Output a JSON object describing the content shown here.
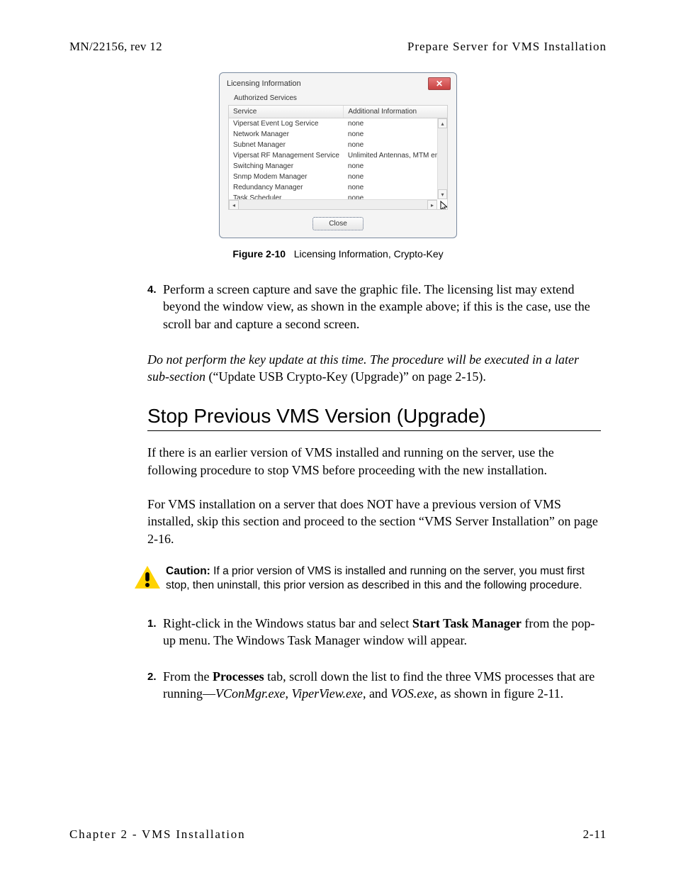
{
  "header": {
    "left": "MN/22156, rev 12",
    "right": "Prepare Server for VMS Installation"
  },
  "dialog": {
    "title": "Licensing Information",
    "close_x": "✕",
    "group_label": "Authorized Services",
    "col_service": "Service",
    "col_info": "Additional Information",
    "services": [
      {
        "name": "Vipersat Event Log Service",
        "info": "none"
      },
      {
        "name": "Network Manager",
        "info": "none"
      },
      {
        "name": "Subnet Manager",
        "info": "none"
      },
      {
        "name": "Vipersat RF Management Service",
        "info": "Unlimited Antennas, MTM enabled"
      },
      {
        "name": "Switching Manager",
        "info": "none"
      },
      {
        "name": "Snmp Modem Manager",
        "info": "none"
      },
      {
        "name": "Redundancy Manager",
        "info": "none"
      },
      {
        "name": "Task Scheduler",
        "info": "none"
      }
    ],
    "close_btn": "Close"
  },
  "figure": {
    "label": "Figure 2-10",
    "caption": "Licensing Information, Crypto-Key"
  },
  "step4": {
    "num": "4.",
    "text": "Perform a screen capture and save the graphic file. The licensing list may extend beyond the window view, as shown in the example above; if this is the case, use the scroll bar and capture a second screen."
  },
  "note_italic": "Do not perform the key update at this time. The procedure will be executed in a later sub-section",
  "note_tail": " (“Update USB Crypto-Key (Upgrade)” on page 2-15).",
  "section_title": "Stop Previous VMS Version (Upgrade)",
  "p1": "If there is an earlier version of VMS installed and running on the server, use the following procedure to stop VMS before proceeding with the new installation.",
  "p2": "For VMS installation on a server that does NOT have a previous version of VMS installed, skip this section and proceed to the section “VMS Server Installation” on page 2-16.",
  "caution": {
    "label": "Caution:",
    "text": "If a prior version of VMS is installed and running on the server, you must first stop, then uninstall, this prior version as described in this and the following procedure."
  },
  "step1": {
    "num": "1.",
    "pre": "Right-click in the Windows status bar and select ",
    "bold": "Start Task Manager",
    "post": " from the pop-up menu. The Windows Task Manager window will appear."
  },
  "step2": {
    "num": "2.",
    "pre": "From the ",
    "bold1": "Processes",
    "mid1": " tab, scroll down the list to find the three VMS processes that are running—",
    "it1": "VConMgr.exe",
    "sep1": ", ",
    "it2": "ViperView.exe",
    "sep2": ", and ",
    "it3": "VOS.exe",
    "post": ", as shown in figure 2-11."
  },
  "footer": {
    "left": "Chapter 2 - VMS Installation",
    "right": "2-11"
  }
}
